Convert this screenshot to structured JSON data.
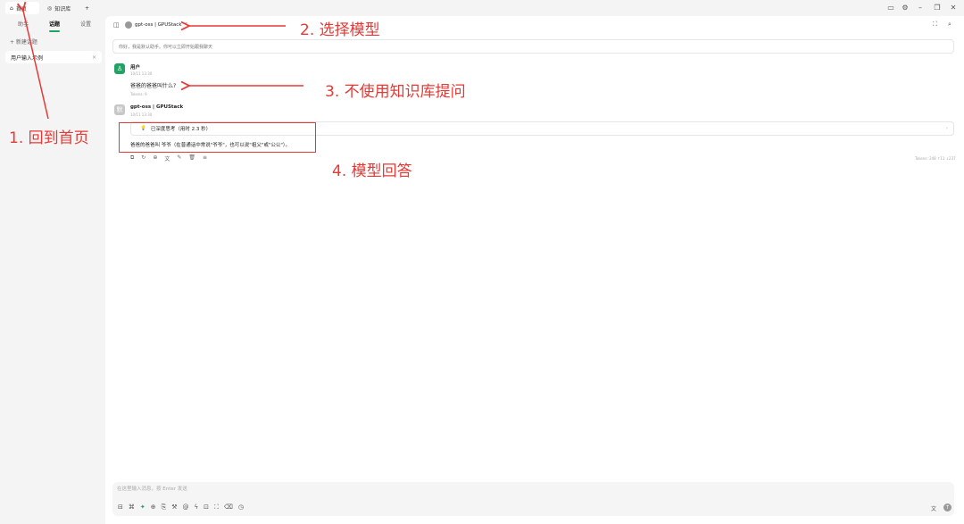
{
  "tabs": [
    {
      "label": "首页",
      "icon": "home-icon"
    },
    {
      "label": "知识库",
      "icon": "knowledge-icon"
    }
  ],
  "add_tab": "+",
  "window_controls": [
    "monitor-icon",
    "gear-icon",
    "minimize-icon",
    "restore-icon",
    "close-icon"
  ],
  "sidebar": {
    "tabs": [
      "助手",
      "话题",
      "设置"
    ],
    "new_topic": "+ 新建话题",
    "topic": "用户输入示例",
    "topic_close": "×"
  },
  "header": {
    "model": "gpt-oss | GPUStack",
    "chevron": "⌃"
  },
  "prompt_placeholder": "你好，我是默认助手。你可以立即开始跟我聊天",
  "messages": {
    "user": {
      "name": "用户",
      "time": "10/11 13:30",
      "text": "爸爸的爸爸叫什么?",
      "tokens": "Tokens: 9"
    },
    "assistant": {
      "avatar": "默",
      "name": "gpt-oss | GPUStack",
      "time": "10/11 13:30",
      "think": "已深度思考（用时 2.3 秒）",
      "answer": "爸爸的爸爸叫 爷爷（在普通话中常说\"爷爷\"，也可以说\"祖父\"或\"公公\"）。",
      "tokens": "Tokens: 248 ↑11 ↓237"
    }
  },
  "input": {
    "placeholder": "在这里输入消息，按 Enter 发送"
  },
  "annotations": {
    "a1": "1. 回到首页",
    "a2": "2. 选择模型",
    "a3": "3. 不使用知识库提问",
    "a4": "4. 模型回答"
  },
  "accent_color": "#21a366",
  "annotation_color": "#e53935"
}
